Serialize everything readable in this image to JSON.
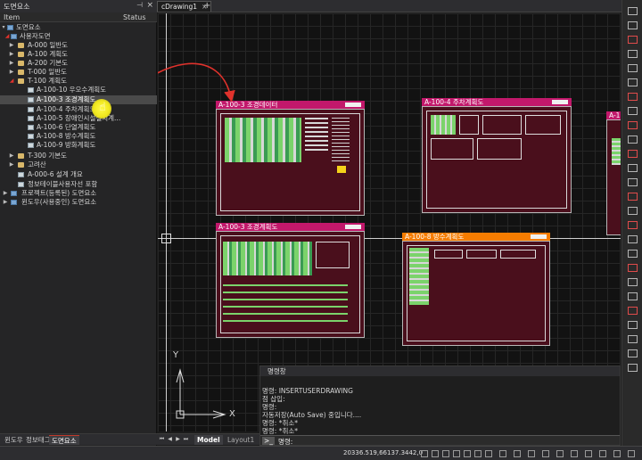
{
  "panel": {
    "title": "도면요소",
    "pin_icon": "pin-icon",
    "close_label": "×",
    "col_item": "Item",
    "col_status": "Status",
    "tree": [
      {
        "label": "도면요소"
      },
      {
        "label": "사용자도면"
      },
      {
        "label": "A-000 일반도"
      },
      {
        "label": "A-100 계획도"
      },
      {
        "label": "A-200 기본도"
      },
      {
        "label": "T-000 일반도"
      },
      {
        "label": "T-100 계획도"
      },
      {
        "label": "A-100-10 우오수계획도"
      },
      {
        "label": "A-100-3 조경계획도"
      },
      {
        "label": "A-100-4 주차계획도"
      },
      {
        "label": "A-100-5 장애인시설설치계..."
      },
      {
        "label": "A-100-6 단열계획도"
      },
      {
        "label": "A-100-8 방수계획도"
      },
      {
        "label": "A-100-9 방화계획도"
      },
      {
        "label": "T-300 기본도"
      },
      {
        "label": "고려산"
      },
      {
        "label": "A-000-6 설계 개요"
      },
      {
        "label": "정보테이블사용자선 포함"
      },
      {
        "label": "프로젝트(등록된) 도면요소"
      },
      {
        "label": "윈도우(사용중인) 도면요소"
      }
    ],
    "tabs": [
      "윈도우",
      "정보태그",
      "도면요소"
    ]
  },
  "document_tabs": {
    "drawing_tab": "cDrawing1",
    "close_label": "×",
    "add_label": "+"
  },
  "canvas": {
    "sheets": [
      {
        "title": "A-100-3 조경데이터",
        "color": "#c2186b"
      },
      {
        "title": "A-100-4 주차계획도",
        "color": "#c2186b"
      },
      {
        "title": "A-1",
        "color": "#c2186b"
      },
      {
        "title": "A-100-3 조경계획도",
        "color": "#c2186b"
      },
      {
        "title": "A-100-8 방수계획도",
        "color": "#f57c00"
      }
    ],
    "ucs_y": "Y",
    "ucs_x": "X"
  },
  "command": {
    "header": "명령창",
    "lines": [
      "명령: INSERTUSERDRAWING",
      "점 삽입:",
      "명령:",
      "자동저장(Auto Save) 중입니다....",
      "명령: *취소*",
      "명령: *취소*"
    ],
    "prompt": ">_",
    "input_label": "명령:"
  },
  "layout_tabs": [
    "Model",
    "Layout1"
  ],
  "status": {
    "coordinates": "20336.519,66137.3442,0"
  },
  "colors": {
    "accent_red": "#e0322c",
    "sheet_bg": "#4a0f1c",
    "highlight_yellow": "#f1e81e"
  }
}
